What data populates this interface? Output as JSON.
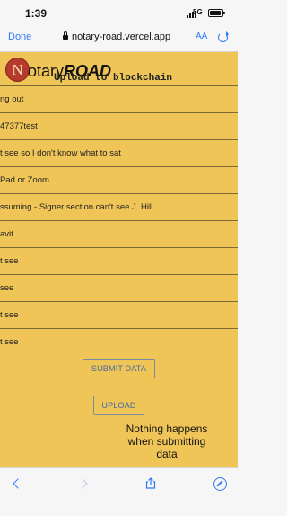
{
  "status_bar": {
    "time": "1:39",
    "network": "5G"
  },
  "browser": {
    "done_label": "Done",
    "url": "notary-road.vercel.app",
    "text_size_label": "AA",
    "reload_icon": "reload-icon",
    "toolbar_icons": [
      "back-icon",
      "forward-icon",
      "share-icon",
      "compass-icon"
    ]
  },
  "page": {
    "logo_letter": "N",
    "logo_text": "otary",
    "logo_emphasis": "ROAD",
    "heading": "Upload to blockchain",
    "rows": [
      "ng out",
      "47377test",
      "t see so I don't know what to sat",
      "Pad or Zoom",
      "ssuming - Signer section can't see J. Hill",
      "avit",
      "t see",
      "see",
      "t see",
      "t see"
    ],
    "submit_label": "SUBMIT DATA",
    "upload_label": "UPLOAD",
    "note": "Nothing happens when submitting data"
  },
  "colors": {
    "page_background": "#efc558",
    "logo_red": "#b83a2c",
    "link_blue": "#2f7bf5",
    "button_text": "#4768a4"
  }
}
